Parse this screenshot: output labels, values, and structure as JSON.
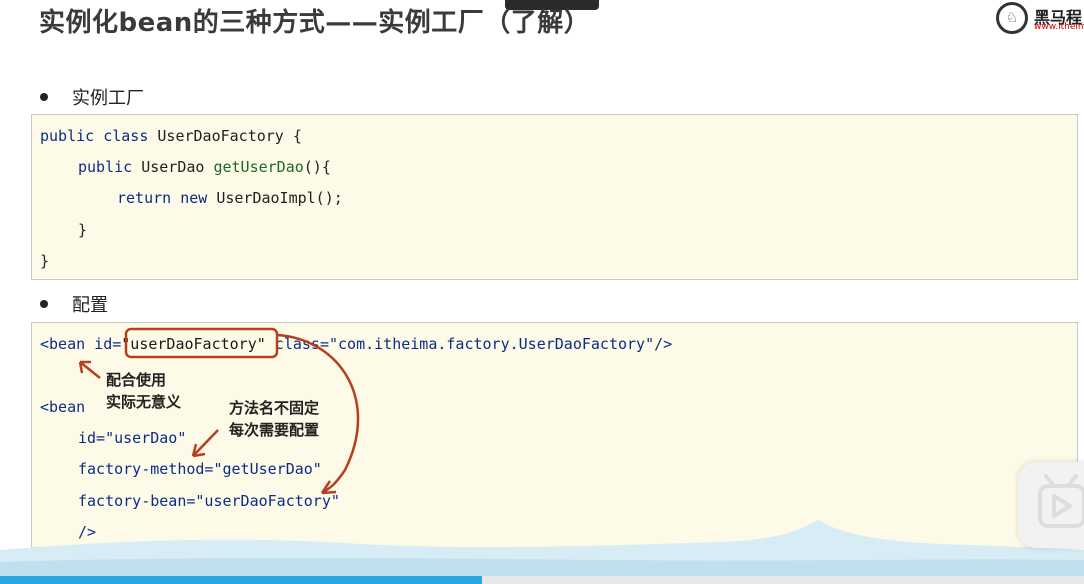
{
  "slide": {
    "title": "实例化bean的三种方式——实例工厂（了解）",
    "logo_name": "黑马程",
    "logo_url": "www.itheim"
  },
  "section1": {
    "bullet": "实例工厂",
    "code": [
      {
        "parts": [
          [
            "kw",
            "public class "
          ],
          [
            "plain",
            "UserDaoFactory {"
          ]
        ]
      },
      {
        "parts": [
          [
            "kw",
            "public "
          ],
          [
            "plain",
            "UserDao "
          ],
          [
            "fn",
            "getUserDao"
          ],
          [
            "plain",
            "(){"
          ]
        ]
      },
      {
        "parts": [
          [
            "kw",
            "return new "
          ],
          [
            "plain",
            "UserDaoImpl();"
          ]
        ]
      },
      {
        "parts": [
          [
            "plain",
            "}"
          ]
        ]
      },
      {
        "parts": [
          [
            "plain",
            "}"
          ]
        ]
      }
    ]
  },
  "section2": {
    "bullet": "配置",
    "code": {
      "line1_tag": "<bean ",
      "line1_id_attr": "id=",
      "line1_id_value": "\"userDaoFactory\"",
      "line1_rest": " class=\"com.itheima.factory.UserDaoFactory\"/>",
      "line2": "<bean",
      "line3": "id=\"userDao\"",
      "line4": "factory-method=\"getUserDao\"",
      "line5": "factory-bean=\"userDaoFactory\"",
      "line6": "/>"
    },
    "note1": [
      "配合使用",
      "实际无意义"
    ],
    "note2": [
      "方法名不固定",
      "每次需要配置"
    ]
  },
  "player": {
    "progress": 0.445
  },
  "colors": {
    "code_bg": "#fdfae7",
    "annotation": "#b5401f",
    "progress": "#2aa7e0"
  }
}
